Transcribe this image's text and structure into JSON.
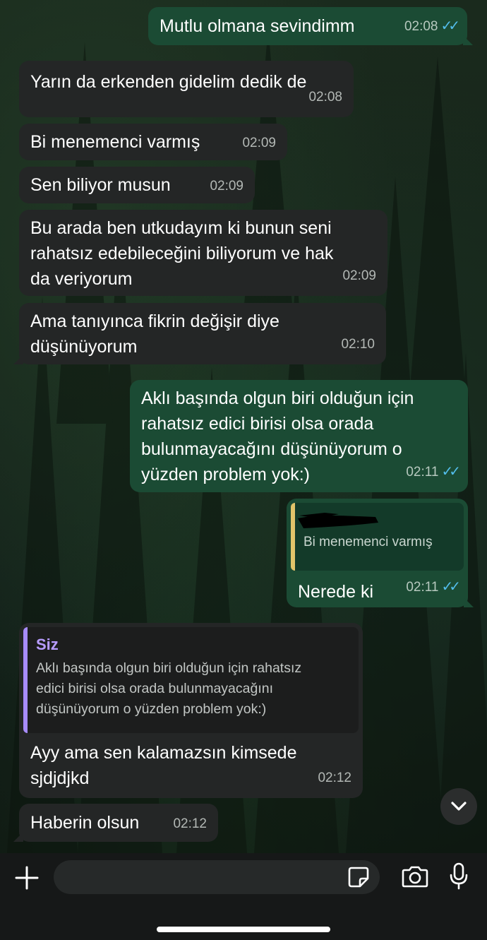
{
  "messages": [
    {
      "text": "Mutlu olmana sevindimm",
      "time": "02:08"
    },
    {
      "text": "Yarın da erkenden gidelim dedik de",
      "time": "02:08"
    },
    {
      "text": "Bi menemenci varmış",
      "time": "02:09"
    },
    {
      "text": "Sen biliyor musun",
      "time": "02:09"
    },
    {
      "lines": [
        "Bu arada ben utkudayım ki bunun seni",
        "rahatsız edebileceğini biliyorum ve hak",
        "da  veriyorum"
      ],
      "time": "02:09"
    },
    {
      "lines": [
        "Ama tanıyınca fikrin değişir diye",
        "düşünüyorum"
      ],
      "time": "02:10"
    },
    {
      "lines": [
        "Aklı başında olgun biri olduğun için",
        "rahatsız edici birisi olsa orada",
        "bulunmayacağını düşünüyorum o",
        "yüzden problem yok:)"
      ],
      "time": "02:11"
    },
    {
      "quote": "Bi menemenci varmış",
      "text": "Nerede ki",
      "time": "02:11"
    },
    {
      "quote_author": "Siz",
      "quote_lines": [
        "Aklı başında olgun biri olduğun için rahatsız",
        "edici birisi olsa orada bulunmayacağını",
        "düşünüyorum o yüzden problem yok:)"
      ],
      "lines": [
        "Ayy ama sen kalamazsın kimsede",
        "sjdjdjkd"
      ],
      "time": "02:12"
    },
    {
      "text": "Haberin olsun",
      "time": "02:12"
    }
  ],
  "read_tick": "✓✓",
  "colors": {
    "incoming": "#242626",
    "outgoing": "#1b4b34",
    "tick": "#53bdeb",
    "quote_bar_yellow": "#e2c46a",
    "quote_bar_purple": "#a78bfa",
    "quote_author": "#b79cff"
  },
  "icons": [
    "plus-icon",
    "sticker-icon",
    "camera-icon",
    "microphone-icon",
    "chevron-down-icon"
  ]
}
